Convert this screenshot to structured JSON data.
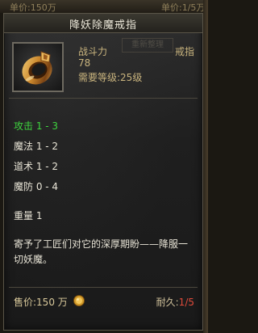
{
  "background": {
    "left_fragment": "单价:150万",
    "right_fragment": "单价:1/5万",
    "ghost_tab_label": "重新整理"
  },
  "tooltip": {
    "title": "降妖除魔戒指",
    "icon": "gold-ring-icon",
    "combat_power_label": "战斗力",
    "combat_power_value": "78",
    "item_type": "戒指",
    "required_level": "需要等级:25级",
    "stats": {
      "attack": "攻击 1 - 3",
      "magic": "魔法 1 - 2",
      "taoism": "道术 1 - 2",
      "magic_defense": "魔防 0 - 4"
    },
    "weight": "重量 1",
    "description": "寄予了工匠们对它的深厚期盼——降服一切妖魔。",
    "price": "售价:150 万",
    "price_icon": "gold-coin-icon",
    "durability_label": "耐久:",
    "durability_current": "1",
    "durability_rest": "/5"
  },
  "colors": {
    "title": "#eae6d8",
    "gold_text": "#c9b47e",
    "stat_highlight": "#3ed43e",
    "durability_current": "#e14b3b"
  }
}
